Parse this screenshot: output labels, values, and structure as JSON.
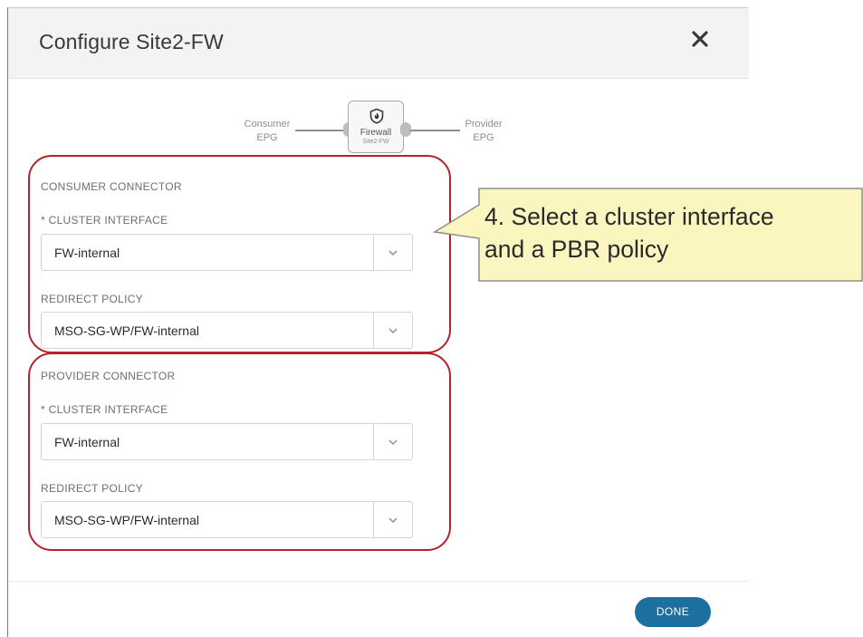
{
  "dialog": {
    "title": "Configure Site2-FW",
    "close_icon": "close-icon",
    "done_label": "DONE"
  },
  "graph": {
    "consumer_label_line1": "Consumer",
    "consumer_label_line2": "EPG",
    "provider_label_line1": "Provider",
    "provider_label_line2": "EPG",
    "node_name": "Firewall",
    "node_sub": "Site2-FW",
    "node_icon": "firewall-icon"
  },
  "consumer_connector": {
    "title": "CONSUMER CONNECTOR",
    "cluster_interface_label": "* CLUSTER INTERFACE",
    "cluster_interface_value": "FW-internal",
    "redirect_policy_label": "REDIRECT POLICY",
    "redirect_policy_value": "MSO-SG-WP/FW-internal"
  },
  "provider_connector": {
    "title": "PROVIDER CONNECTOR",
    "cluster_interface_label": "* CLUSTER INTERFACE",
    "cluster_interface_value": "FW-internal",
    "redirect_policy_label": "REDIRECT POLICY",
    "redirect_policy_value": "MSO-SG-WP/FW-internal"
  },
  "callout": {
    "line1": "4. Select a cluster interface",
    "line2": "and a PBR policy"
  },
  "colors": {
    "accent_button": "#1d6fa0",
    "highlight_outline": "#b5222b",
    "callout_fill": "#fbf6c0"
  }
}
